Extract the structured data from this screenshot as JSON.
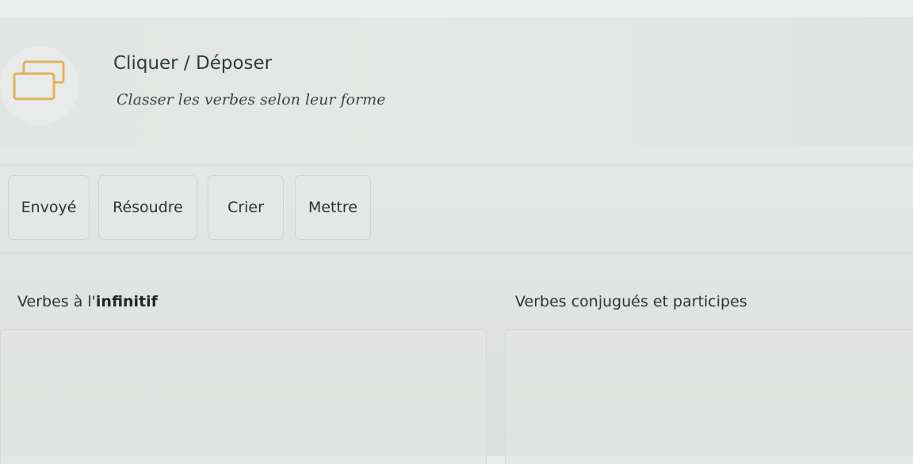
{
  "header": {
    "icon": "drag-drop-icon",
    "title": "Cliquer / Déposer",
    "subtitle": "Classer les verbes selon leur forme"
  },
  "bank": {
    "items": [
      "Envoyé",
      "Résoudre",
      "Crier",
      "Mettre"
    ]
  },
  "columns": {
    "left": {
      "label_prefix": "Verbes à l'",
      "label_bold": "infinitif"
    },
    "right": {
      "label": "Verbes conjugués et participes"
    }
  },
  "colors": {
    "icon_accent": "#e2b25a",
    "text": "#2c3336",
    "border": "#cfd3d1"
  }
}
